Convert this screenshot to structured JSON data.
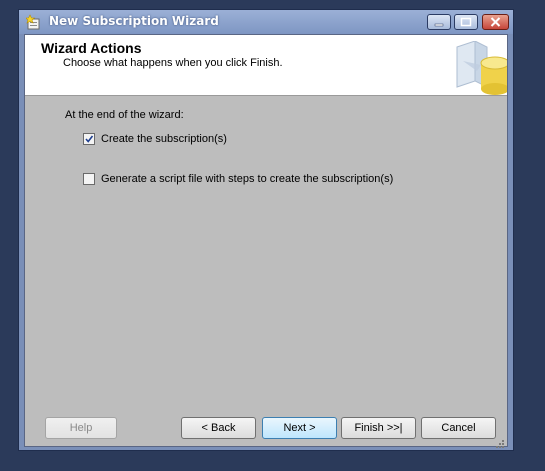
{
  "window": {
    "title": "New Subscription Wizard",
    "accent": "#7a8fb8"
  },
  "header": {
    "title": "Wizard Actions",
    "subtitle": "Choose what happens when you click Finish."
  },
  "main": {
    "intro": "At the end of the wizard:",
    "options": [
      {
        "label": "Create the subscription(s)",
        "checked": true
      },
      {
        "label": "Generate a script file with steps to create the subscription(s)",
        "checked": false
      }
    ]
  },
  "buttons": {
    "help": "Help",
    "back": "< Back",
    "next": "Next >",
    "finish": "Finish >>|",
    "cancel": "Cancel"
  }
}
